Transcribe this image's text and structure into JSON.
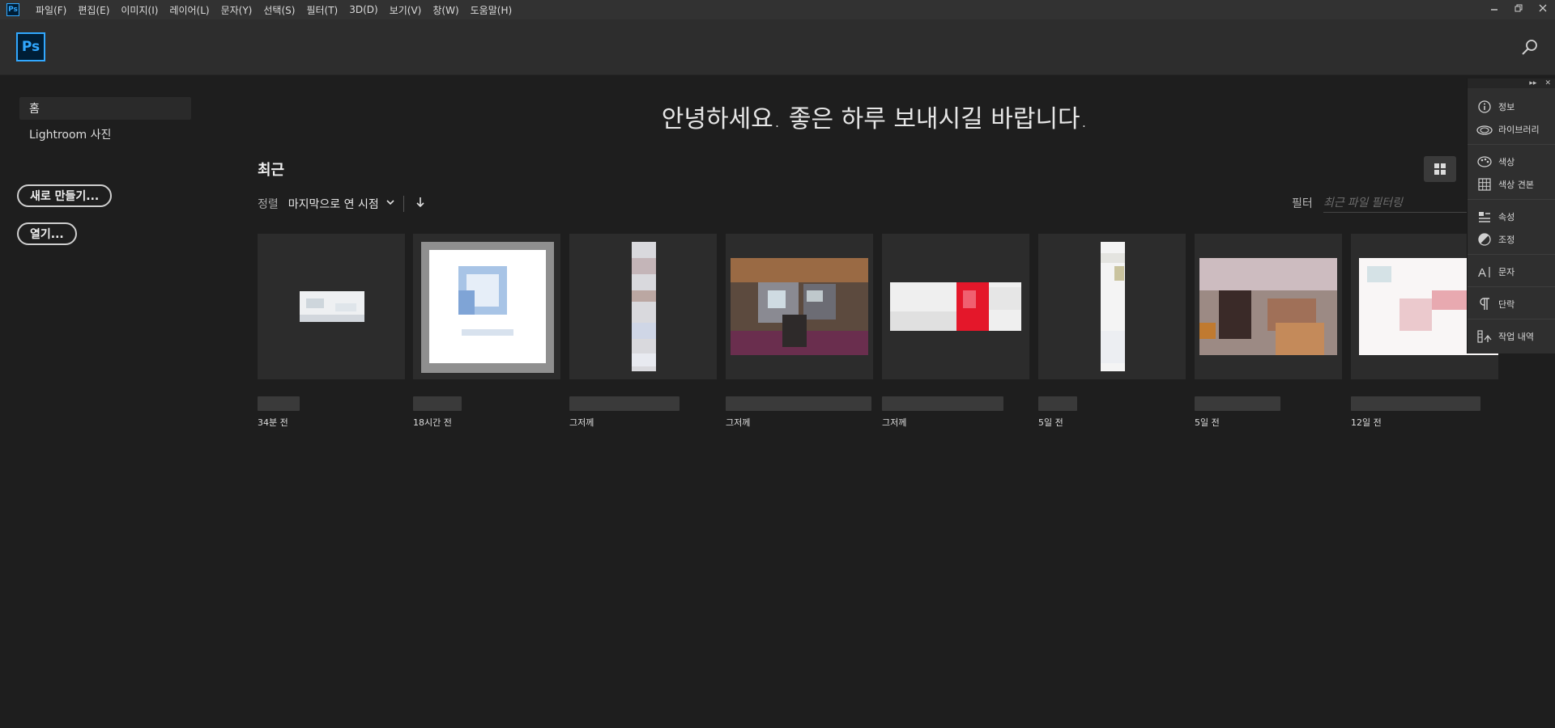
{
  "menubar": {
    "app_icon": "Ps",
    "items": [
      "파일(F)",
      "편집(E)",
      "이미지(I)",
      "레이어(L)",
      "문자(Y)",
      "선택(S)",
      "필터(T)",
      "3D(D)",
      "보기(V)",
      "창(W)",
      "도움말(H)"
    ]
  },
  "header": {
    "logo": "Ps"
  },
  "nav": {
    "home": "홈",
    "lightroom": "Lightroom 사진"
  },
  "actions": {
    "new": "새로 만들기...",
    "open": "열기..."
  },
  "main": {
    "greeting": "안녕하세요. 좋은 하루 보내시길 바랍니다.",
    "recent_title": "최근",
    "sort_label": "정렬",
    "sort_value": "마지막으로 연 시점",
    "filter_label": "필터",
    "filter_placeholder": "최근 파일 필터링"
  },
  "recent_files": [
    {
      "time": "34분 전"
    },
    {
      "time": "18시간 전"
    },
    {
      "time": "그저께"
    },
    {
      "time": "그저께"
    },
    {
      "time": "그저께"
    },
    {
      "time": "5일 전"
    },
    {
      "time": "5일 전"
    },
    {
      "time": "12일 전"
    }
  ],
  "panel": {
    "items": [
      "정보",
      "라이브러리",
      "색상",
      "색상 견본",
      "속성",
      "조정",
      "문자",
      "단락",
      "작업 내역"
    ]
  },
  "colors": {
    "accent": "#31a8ff",
    "ps_bg": "#001e36",
    "background": "#1e1e1e"
  }
}
